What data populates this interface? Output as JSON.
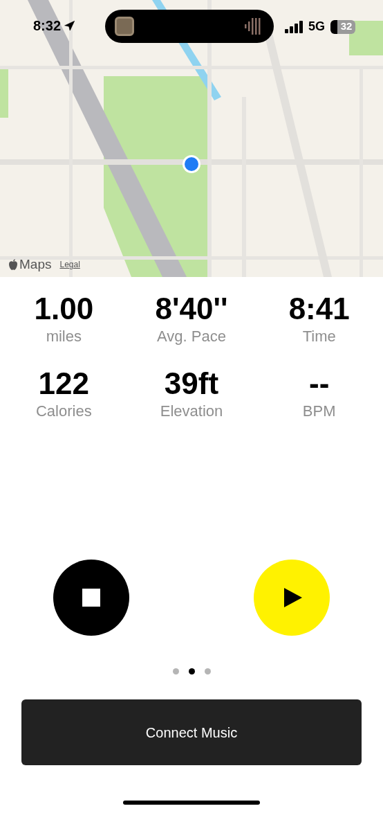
{
  "status_bar": {
    "time": "8:32",
    "network": "5G",
    "battery": "32"
  },
  "map": {
    "attribution": "Maps",
    "legal_link": "Legal"
  },
  "stats": [
    {
      "value": "1.00",
      "label": "miles"
    },
    {
      "value": "8'40''",
      "label": "Avg. Pace"
    },
    {
      "value": "8:41",
      "label": "Time"
    },
    {
      "value": "122",
      "label": "Calories"
    },
    {
      "value": "39ft",
      "label": "Elevation"
    },
    {
      "value": "--",
      "label": "BPM"
    }
  ],
  "controls": [
    {
      "kind": "stop"
    },
    {
      "kind": "play"
    }
  ],
  "page_dots": [
    {
      "selected": false
    },
    {
      "selected": true
    },
    {
      "selected": false
    }
  ],
  "connect_button": "Connect Music"
}
